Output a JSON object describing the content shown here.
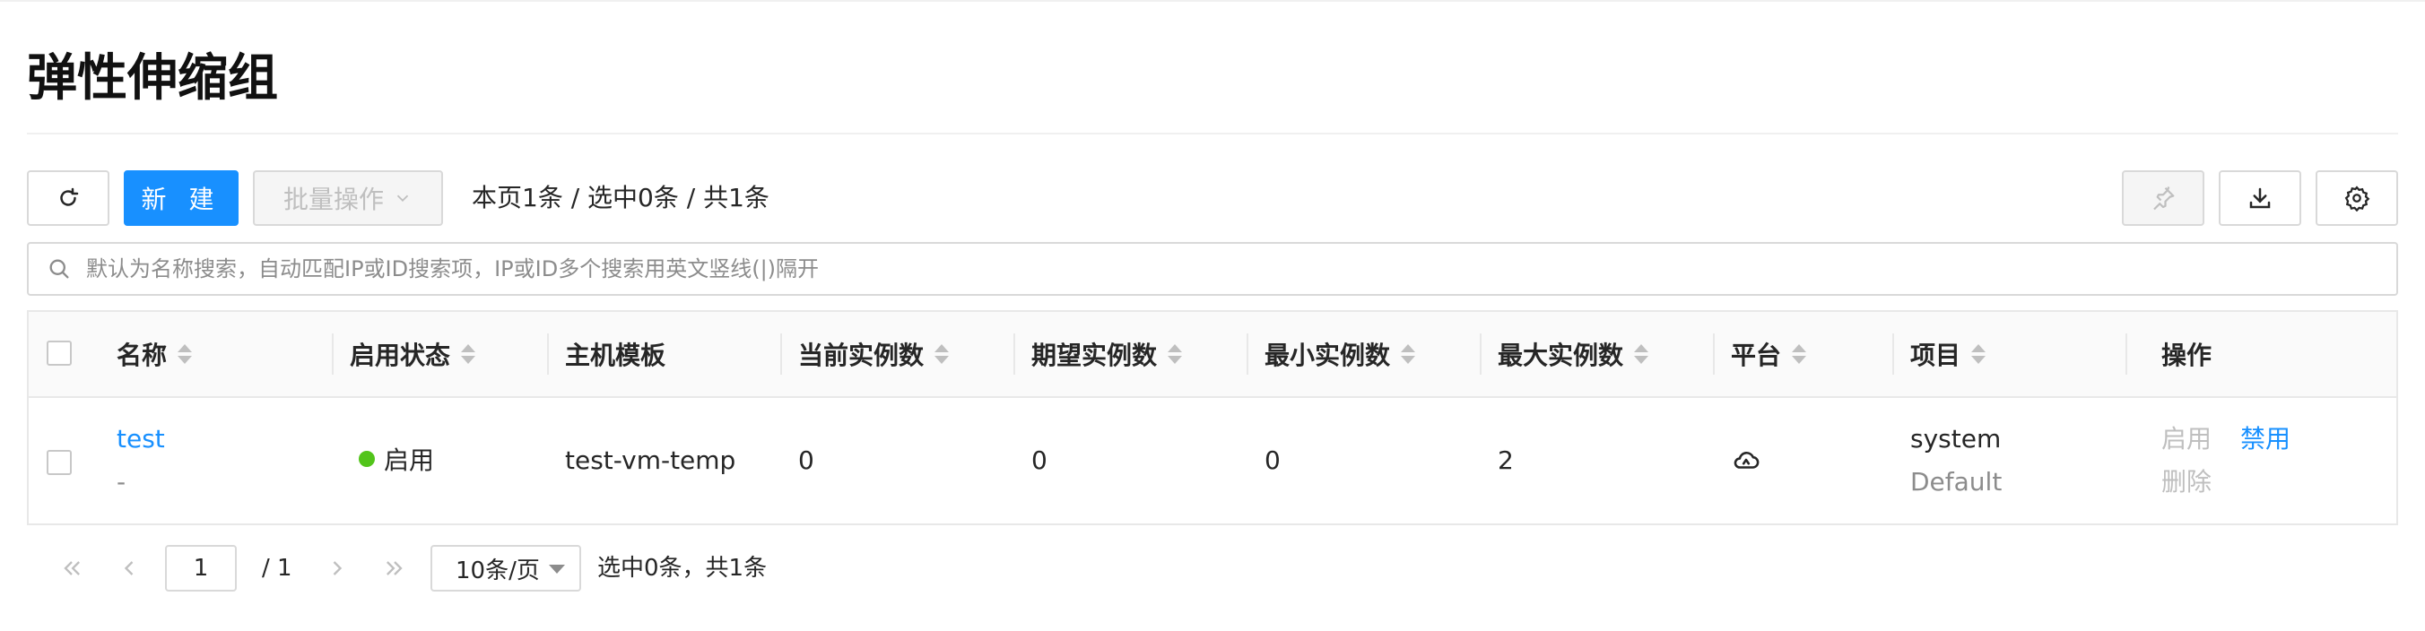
{
  "page": {
    "title": "弹性伸缩组"
  },
  "toolbar": {
    "new_label": "新 建",
    "batch_label": "批量操作",
    "count_text": "本页1条 / 选中0条 / 共1条"
  },
  "search": {
    "placeholder": "默认为名称搜索，自动匹配IP或ID搜索项，IP或ID多个搜索用英文竖线(|)隔开",
    "value": ""
  },
  "table": {
    "columns": [
      "名称",
      "启用状态",
      "主机模板",
      "当前实例数",
      "期望实例数",
      "最小实例数",
      "最大实例数",
      "平台",
      "项目",
      "操作"
    ],
    "rows": [
      {
        "name": "test",
        "description": "-",
        "status": "启用",
        "template": "test-vm-temp",
        "current": "0",
        "desired": "0",
        "min": "0",
        "max": "2",
        "platform_icon": "cloud-icon",
        "project": "system",
        "domain": "Default",
        "actions": {
          "enable": "启用",
          "disable": "禁用",
          "delete": "删除"
        }
      }
    ]
  },
  "pagination": {
    "current_page": "1",
    "total_pages": "/ 1",
    "page_size": "10条/页",
    "info": "选中0条，共1条"
  },
  "colors": {
    "primary": "#1890ff",
    "status_enabled": "#52c41a",
    "disabled_text": "#bfbfbf"
  }
}
